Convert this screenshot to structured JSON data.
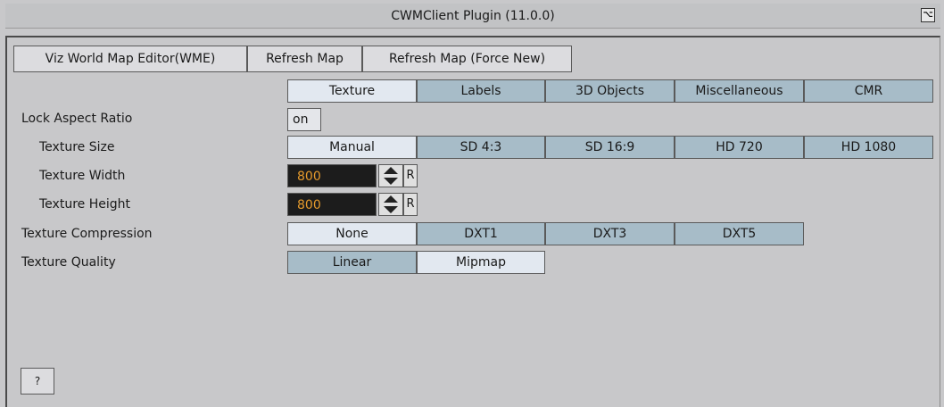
{
  "window": {
    "title": "CWMClient Plugin (11.0.0)",
    "pin_glyph": "⌥"
  },
  "toolbar": {
    "wme_label": "Viz World Map Editor(WME)",
    "refresh_label": "Refresh Map",
    "refresh_force_label": "Refresh Map (Force New)"
  },
  "tabs": [
    {
      "label": "Texture",
      "active": true
    },
    {
      "label": "Labels"
    },
    {
      "label": "3D Objects"
    },
    {
      "label": "Miscellaneous"
    },
    {
      "label": "CMR"
    }
  ],
  "fields": {
    "lock_aspect_label": "Lock Aspect Ratio",
    "lock_aspect_value": "on",
    "texture_size_label": "Texture Size",
    "texture_size_options": [
      "Manual",
      "SD 4:3",
      "SD 16:9",
      "HD 720",
      "HD 1080"
    ],
    "texture_width_label": "Texture Width",
    "texture_width_value": "800",
    "texture_height_label": "Texture Height",
    "texture_height_value": "800",
    "reset_label": "R",
    "compression_label": "Texture Compression",
    "compression_options": [
      "None",
      "DXT1",
      "DXT3",
      "DXT5"
    ],
    "quality_label": "Texture Quality",
    "quality_options": [
      "Linear",
      "Mipmap"
    ]
  },
  "help_label": "?"
}
